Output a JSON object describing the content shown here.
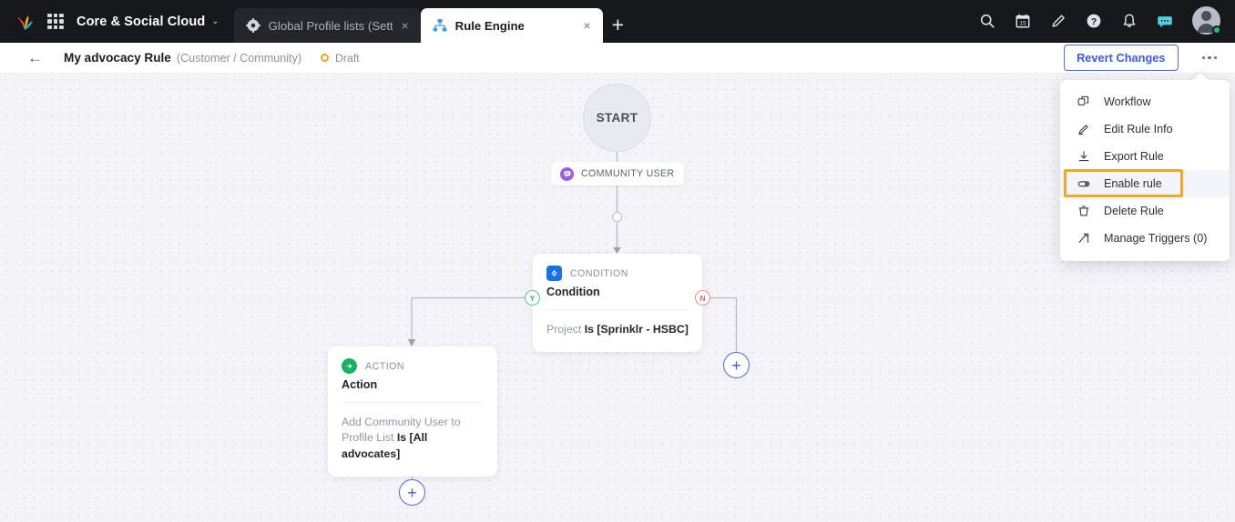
{
  "topbar": {
    "logo_icon": "sprinklr-logo-icon",
    "grid_icon": "app-switcher-grid-icon",
    "app_name": "Core & Social Cloud",
    "chevron": "⌄",
    "tabs": [
      {
        "label": "Global Profile lists (Setti",
        "icon": "gear-icon",
        "close": "×",
        "active": false
      },
      {
        "label": "Rule Engine",
        "icon": "hierarchy-icon",
        "close": "×",
        "active": true
      }
    ],
    "new_tab": "+",
    "icons": [
      "search-icon",
      "calendar-icon",
      "edit-pencil-icon",
      "help-circle-icon",
      "bell-icon",
      "chat-bubble-icon",
      "avatar"
    ],
    "calendar_day": "15",
    "status_dot_color": "#1fc16b",
    "chat_icon_color": "#4fd1e0"
  },
  "subheader": {
    "back": "←",
    "title": "My advocacy Rule",
    "subtitle": "(Customer / Community)",
    "status": "Draft",
    "status_color": "#f0a229",
    "revert_label": "Revert Changes",
    "kebab": "more-options"
  },
  "canvas": {
    "start_label": "START",
    "trigger_chip": {
      "label": "COMMUNITY USER",
      "icon": "community-user-icon",
      "icon_color": "#9b5de5"
    },
    "condition_card": {
      "kind": "CONDITION",
      "title": "Condition",
      "rule_prefix": "Project ",
      "rule_value": "Is [Sprinklr - HSBC]",
      "icon": "condition-diamond-icon",
      "icon_color": "#1672ec"
    },
    "action_card": {
      "kind": "ACTION",
      "title": "Action",
      "rule_prefix": "Add Community User to Profile List ",
      "rule_value": "Is [All advocates]",
      "icon": "action-arrow-icon",
      "icon_color": "#16b364"
    },
    "branch_yes": "Y",
    "branch_no": "N",
    "add_button": "+"
  },
  "menu": {
    "items": [
      {
        "label": "Workflow",
        "icon": "workflow-icon",
        "highlight": false
      },
      {
        "label": "Edit Rule Info",
        "icon": "pencil-icon",
        "highlight": false
      },
      {
        "label": "Export Rule",
        "icon": "download-icon",
        "highlight": false
      },
      {
        "label": "Enable rule",
        "icon": "toggle-switch-icon",
        "highlight": true
      },
      {
        "label": "Delete Rule",
        "icon": "trash-icon",
        "highlight": false
      },
      {
        "label": "Manage Triggers (0)",
        "icon": "triggers-icon",
        "highlight": false
      }
    ],
    "highlight_color": "#f5a623"
  }
}
